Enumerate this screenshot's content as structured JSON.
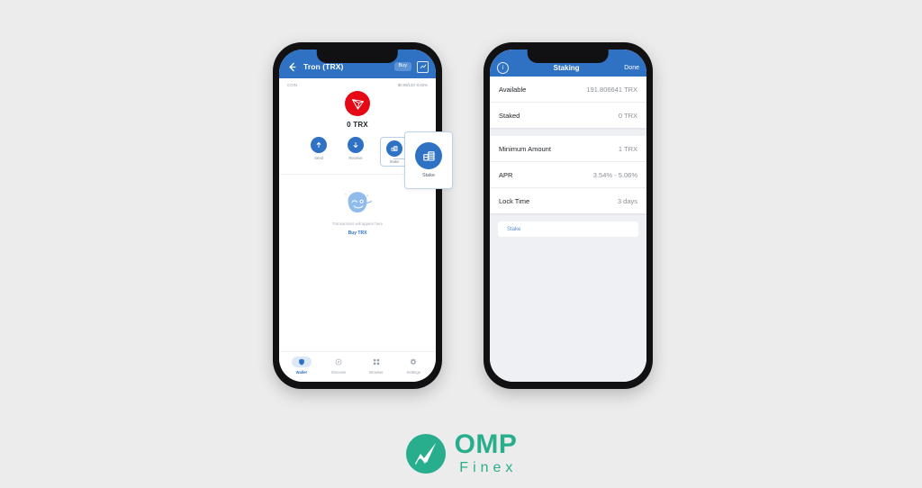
{
  "background_color": "#ececec",
  "brand": {
    "mark_icon": "omp-logo-mark",
    "name_primary": "OMP",
    "name_secondary": "Finex",
    "color": "#29ae8d"
  },
  "left_phone": {
    "device": "iphone-black",
    "header": {
      "back_icon": "arrow-left-icon",
      "title": "Tron (TRX)",
      "buy_label": "Buy",
      "chart_icon": "chart-icon",
      "background": "#2f72c4"
    },
    "coin_meta": {
      "label": "COIN",
      "price": "$0.06/133 -0.02%"
    },
    "coin": {
      "symbol_icon": "tron-icon",
      "icon_color": "#e50915",
      "balance": "0 TRX"
    },
    "actions": [
      {
        "label": "Send",
        "icon": "upload-arrow-icon"
      },
      {
        "label": "Receive",
        "icon": "download-arrow-icon"
      },
      {
        "label": "Stake",
        "icon": "coin-stack-icon",
        "highlighted": true
      }
    ],
    "empty_state": {
      "art_icon": "blob-mascot-icon",
      "message": "Transactions will appear here",
      "cta_label": "Buy TRX"
    },
    "tabs": [
      {
        "label": "Wallet",
        "icon": "shield-icon",
        "active": true
      },
      {
        "label": "Discover",
        "icon": "compass-icon",
        "active": false
      },
      {
        "label": "Browser",
        "icon": "grid-icon",
        "active": false
      },
      {
        "label": "Settings",
        "icon": "gear-icon",
        "active": false
      }
    ]
  },
  "callout": {
    "icon": "coin-stack-icon",
    "label": "Stake"
  },
  "right_phone": {
    "device": "iphone-black",
    "header": {
      "info_icon": "info-icon",
      "title": "Staking",
      "done_label": "Done",
      "background": "#2f72c4"
    },
    "balance_card": [
      {
        "label": "Available",
        "value": "191.806641 TRX"
      },
      {
        "label": "Staked",
        "value": "0 TRX"
      }
    ],
    "terms_card": [
      {
        "label": "Minimum Amount",
        "value": "1 TRX"
      },
      {
        "label": "APR",
        "value": "3.54% - 5.06%"
      },
      {
        "label": "Lock Time",
        "value": "3 days"
      }
    ],
    "stake_button_label": "Stake"
  }
}
